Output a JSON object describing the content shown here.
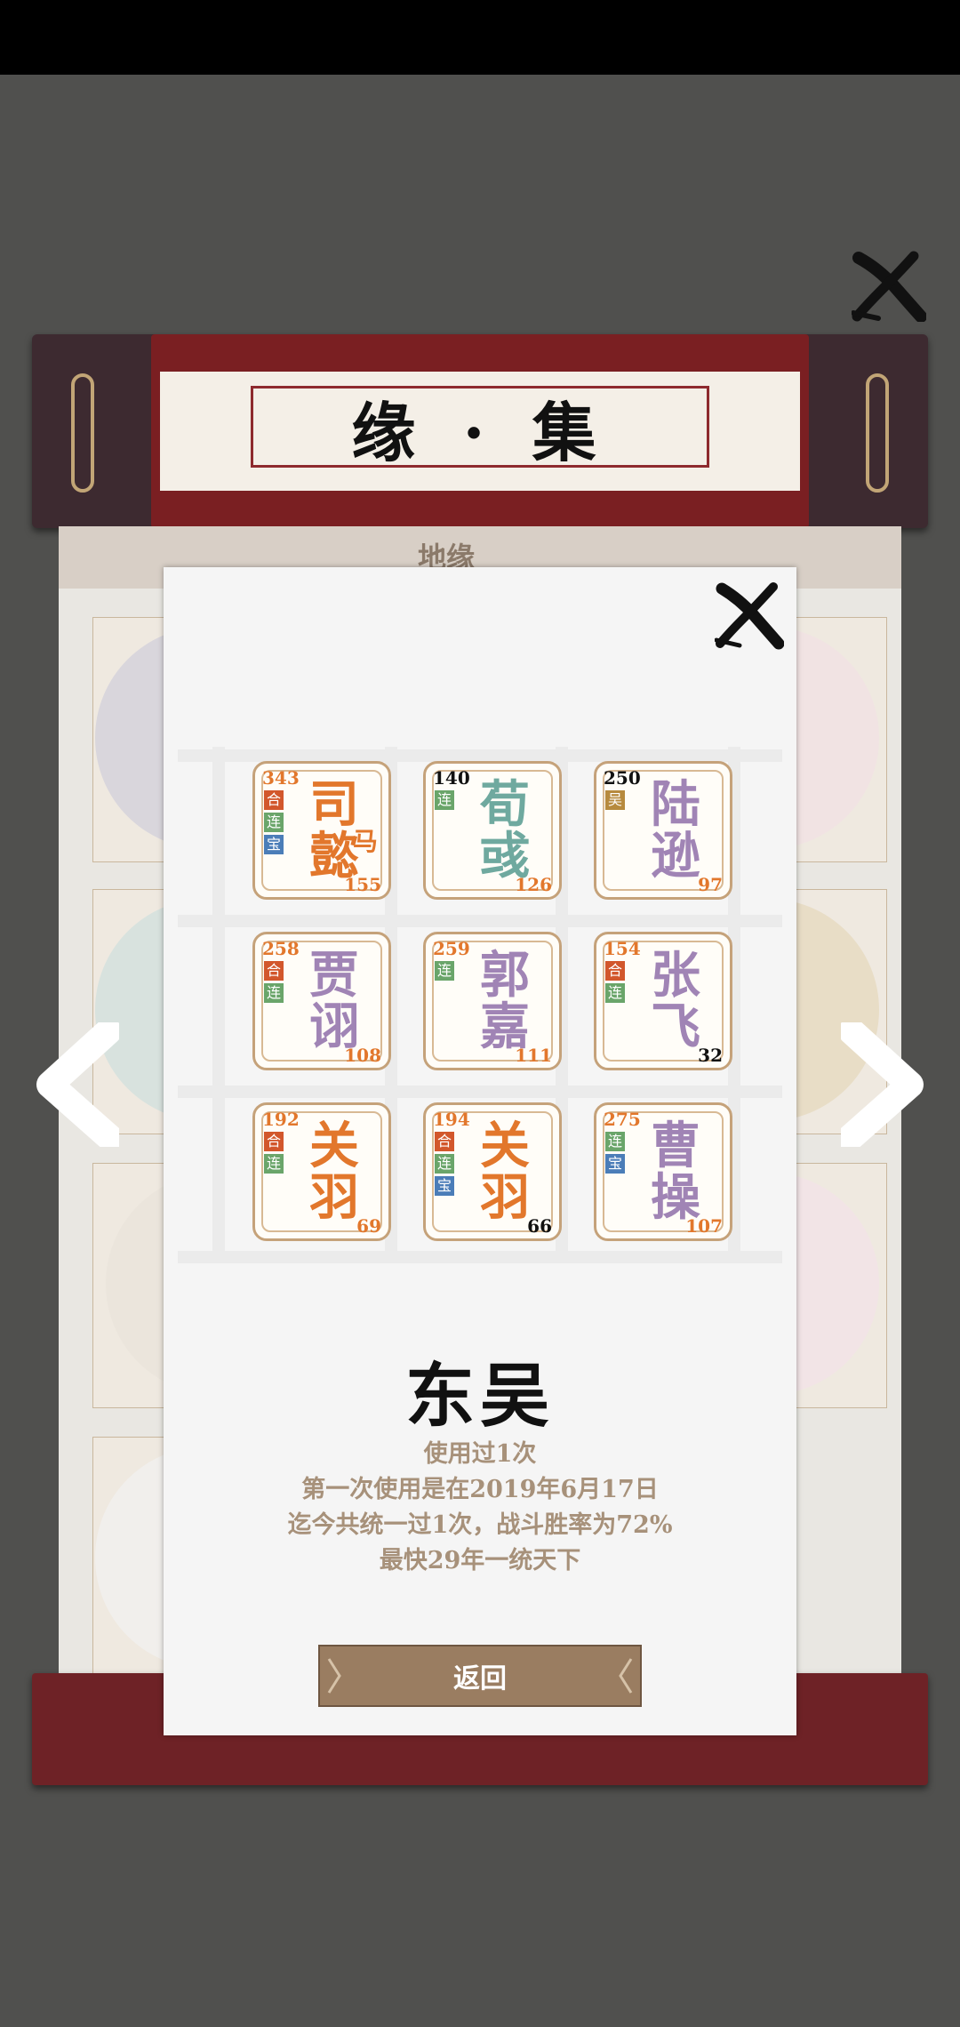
{
  "scroll": {
    "title": "缘 · 集",
    "tab_label": "地缘"
  },
  "popup": {
    "faction": "东吴",
    "stats": [
      "使用过1次",
      "第一次使用是在2019年6月17日",
      "迄今共统一过1次，战斗胜率为72%",
      "最快29年一统天下"
    ],
    "return_label": "返回"
  },
  "colors": {
    "orange": "#e2772c",
    "teal": "#6fa99f",
    "purple": "#a084b5",
    "badge_he": "#d2572c",
    "badge_lian": "#6aa56a",
    "badge_bao": "#4b7db8",
    "badge_wu": "#b78a3e"
  },
  "tiles": [
    {
      "name1": "司",
      "name2": "懿",
      "extra": "马",
      "color": "orange",
      "top": "343",
      "top_color": "#e2772c",
      "bottom": "155",
      "bottom_color": "#e2772c",
      "badges": [
        {
          "t": "合",
          "c": "badge_he"
        },
        {
          "t": "连",
          "c": "badge_lian"
        },
        {
          "t": "宝",
          "c": "badge_bao"
        }
      ]
    },
    {
      "name1": "荀",
      "name2": "彧",
      "extra": "",
      "color": "teal",
      "top": "140",
      "top_color": "#111111",
      "bottom": "126",
      "bottom_color": "#e2772c",
      "badges": [
        {
          "t": "连",
          "c": "badge_lian"
        }
      ]
    },
    {
      "name1": "陆",
      "name2": "逊",
      "extra": "",
      "color": "purple",
      "top": "250",
      "top_color": "#111111",
      "bottom": "97",
      "bottom_color": "#e2772c",
      "badges": [
        {
          "t": "吴",
          "c": "badge_wu"
        }
      ]
    },
    {
      "name1": "贾",
      "name2": "诩",
      "extra": "",
      "color": "purple",
      "top": "258",
      "top_color": "#e2772c",
      "bottom": "108",
      "bottom_color": "#e2772c",
      "badges": [
        {
          "t": "合",
          "c": "badge_he"
        },
        {
          "t": "连",
          "c": "badge_lian"
        }
      ]
    },
    {
      "name1": "郭",
      "name2": "嘉",
      "extra": "",
      "color": "purple",
      "top": "259",
      "top_color": "#e2772c",
      "bottom": "111",
      "bottom_color": "#e2772c",
      "badges": [
        {
          "t": "连",
          "c": "badge_lian"
        }
      ]
    },
    {
      "name1": "张",
      "name2": "飞",
      "extra": "",
      "color": "purple",
      "top": "154",
      "top_color": "#e2772c",
      "bottom": "32",
      "bottom_color": "#111111",
      "badges": [
        {
          "t": "合",
          "c": "badge_he"
        },
        {
          "t": "连",
          "c": "badge_lian"
        }
      ]
    },
    {
      "name1": "关",
      "name2": "羽",
      "extra": "",
      "color": "orange",
      "top": "192",
      "top_color": "#e2772c",
      "bottom": "69",
      "bottom_color": "#e2772c",
      "badges": [
        {
          "t": "合",
          "c": "badge_he"
        },
        {
          "t": "连",
          "c": "badge_lian"
        }
      ]
    },
    {
      "name1": "关",
      "name2": "羽",
      "extra": "",
      "color": "orange",
      "top": "194",
      "top_color": "#e2772c",
      "bottom": "66",
      "bottom_color": "#111111",
      "badges": [
        {
          "t": "合",
          "c": "badge_he"
        },
        {
          "t": "连",
          "c": "badge_lian"
        },
        {
          "t": "宝",
          "c": "badge_bao"
        }
      ]
    },
    {
      "name1": "曹",
      "name2": "操",
      "extra": "",
      "color": "purple",
      "top": "275",
      "top_color": "#e2772c",
      "bottom": "107",
      "bottom_color": "#e2772c",
      "badges": [
        {
          "t": "连",
          "c": "badge_lian"
        },
        {
          "t": "宝",
          "c": "badge_bao"
        }
      ]
    }
  ]
}
